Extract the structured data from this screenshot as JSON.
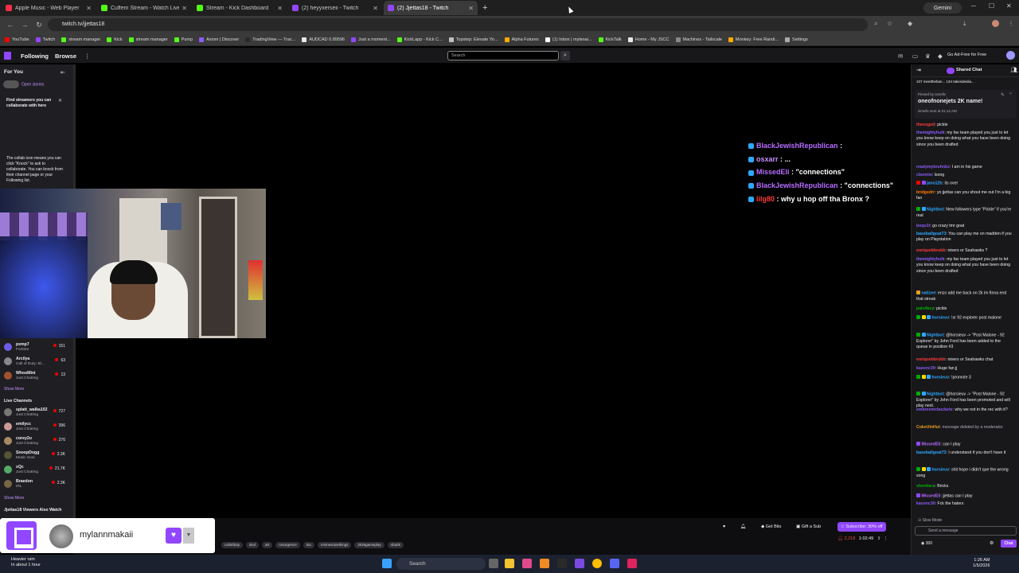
{
  "browser": {
    "tabs": [
      {
        "label": "Apple Music - Web Player",
        "color": "#fa2d48",
        "active": false
      },
      {
        "label": "Cuffem Stream - Watch Live on",
        "color": "#53fc18",
        "active": false
      },
      {
        "label": "Stream - Kick Dashboard",
        "color": "#53fc18",
        "active": false
      },
      {
        "label": "(2) heyyxerseii - Twitch",
        "color": "#9147ff",
        "active": false
      },
      {
        "label": "(2) Jjettas18 - Twitch",
        "color": "#9147ff",
        "active": true
      }
    ],
    "new_tab": "+",
    "gemini_label": "Gemini",
    "url": "twitch.tv/jjettas18",
    "bookmarks": [
      "YouTube",
      "Twitch",
      "stream manager",
      "Kick",
      "stream manager",
      "Pump",
      "Axiom | Discover",
      "TradingView — Trac...",
      "AUDCAD 0.89596",
      "Just a moment...",
      "KickLapp - Kick C...",
      "Topstep: Elevate Yo...",
      "Alpha Futures",
      "(1) Inbox | mylanai...",
      "KickTalk",
      "Home - My JSCC",
      "Machines - Tailscale",
      "Monkey: Free Randi...",
      "Settings"
    ]
  },
  "twitch_nav": {
    "following": "Following",
    "browse": "Browse",
    "search_placeholder": "Search",
    "ad_free": "Go Ad-Free for Free"
  },
  "sidebar": {
    "for_you": "For You",
    "open_stories": "Open stories",
    "find_streamers": "Find streamers you can collaborate with here",
    "collab_info": "The collab icon means you can click \"Knock\" to ask to collaborate. You can knock from their channel page or your Following list.",
    "followed": [
      {
        "name": "pxmp7",
        "game": "Fortnite",
        "viewers": "151"
      },
      {
        "name": "Arcilya",
        "game": "Call of Duty: Bl...",
        "viewers": "63"
      },
      {
        "name": "WhosMini",
        "game": "Just Chatting",
        "viewers": "13"
      }
    ],
    "show_more_1": "Show More",
    "live_channels_header": "Live Channels",
    "live_channels": [
      {
        "name": "splatt_walka102",
        "game": "Just Chatting",
        "viewers": "727"
      },
      {
        "name": "emilycc",
        "game": "Just Chatting",
        "viewers": "396"
      },
      {
        "name": "corey2u",
        "game": "Just Chatting",
        "viewers": "276"
      },
      {
        "name": "SnoopDogg",
        "game": "Music Soul",
        "viewers": "2.3K"
      },
      {
        "name": "xQc",
        "game": "Just Chatting",
        "viewers": "21.7K"
      },
      {
        "name": "Braedon",
        "game": "IRL",
        "viewers": "2.3K"
      }
    ],
    "show_more_2": "Show More",
    "viewers_also_watch": "Jjettas18 Viewers Also Watch"
  },
  "stream_overlay_chat": [
    {
      "user": "BlackJewishRepublican",
      "color": "#b56cff",
      "text": ":"
    },
    {
      "user": "osxarr",
      "color": "#c990ff",
      "text": ": ..."
    },
    {
      "user": "MissedEli",
      "color": "#b56cff",
      "text": ": \"connections\""
    },
    {
      "user": "BlackJewishRepublican",
      "color": "#b56cff",
      "text": ": \"connections\""
    },
    {
      "user": "lilg80",
      "color": "#ff3c3c",
      "text": ": why u hop off tha Bronx ?"
    }
  ],
  "stream_bar": {
    "get_bits": "Get Bits",
    "gift_sub": "Gift a Sub",
    "subscribe": "Subscribe: 30% off",
    "tags": [
      "callofduty",
      "skol",
      "art",
      "rosurgence",
      "tsu",
      "minnesotavikings",
      "2k26gameplay",
      "nba2k"
    ],
    "viewers": "2,218",
    "uptime": "1:02:49"
  },
  "popup": {
    "name": "mylannmakaii",
    "heart": "♥",
    "caret": "▼"
  },
  "chat": {
    "title": "Shared Chat",
    "shared_bar": "107 meettheban... 134 takesidedia...",
    "pinned_label": "Pinned by ismellv",
    "pinned_message": "oneofnonejets 2K name!",
    "pinned_sent": "ismellv sent at 01:12 AM",
    "messages": [
      {
        "user": "theoxgod",
        "color": "#ff3c3c",
        "text": ": pickle",
        "badges": []
      },
      {
        "user": "themightyhulk",
        "color": "#8a5cf6",
        "text": ": my fav team played you just to let you know keep on doing what you have been doing since you been drafted",
        "badges": []
      },
      {
        "user": "readymybruhnbz",
        "color": "#8a5cf6",
        "text": ": I am in his game",
        "badges": []
      },
      {
        "user": "cbonnie",
        "color": "#8a5cf6",
        "text": ": lsong",
        "badges": []
      },
      {
        "user": "jano12b",
        "color": "#2ea8ff",
        "text": ": its over",
        "badges": [
          "#eb0400",
          "#9147ff"
        ]
      },
      {
        "user": "bridgedrr",
        "color": "#ff7a00",
        "text": ": yo jjettas can you shout me out I'm a big fan",
        "badges": []
      },
      {
        "user": "Nightbot",
        "color": "#2ea8ff",
        "text": ": New followers type \"Pickle\" if you're real",
        "badges": [
          "#00ad03",
          "#2ea8ff"
        ]
      },
      {
        "user": "boqu1t",
        "color": "#8a5cf6",
        "text": ": go crazy tmr goat",
        "badges": []
      },
      {
        "user": "baseballgoat73",
        "color": "#2ea8ff",
        "text": ": You can play me on madden if you play on Playstation",
        "badges": []
      },
      {
        "user": "enriquebbrubb",
        "color": "#ff3c3c",
        "text": ": niners or Seahawks ?",
        "badges": []
      },
      {
        "user": "themightyhulk",
        "color": "#8a5cf6",
        "text": ": my fav team played you just to let you know keep on doing what you have been doing since you been drafted",
        "badges": []
      },
      {
        "user": "natizee",
        "color": "#2ea8ff",
        "text": ": enzo add me back on 2k im finna end that streak",
        "badges": [
          "#e6a020"
        ]
      },
      {
        "user": "pain4key",
        "color": "#00ad03",
        "text": ": pickle",
        "badges": []
      },
      {
        "user": "horsieuv",
        "color": "#2ea8ff",
        "text": ": !sr 92 explorer post malone",
        "badges": [
          "#00ad03",
          "#ffd700",
          "#2ea8ff"
        ]
      },
      {
        "user": "Nightbot",
        "color": "#2ea8ff",
        "text": ": @horsieuv -> \"Post Malone - 92 Explorer\" by John Ford has been added to the queue in position #3",
        "badges": [
          "#00ad03",
          "#2ea8ff"
        ]
      },
      {
        "user": "enriquebbrubb",
        "color": "#ff3c3c",
        "text": ": niners or Seahawks chat",
        "badges": []
      },
      {
        "user": "kasonc30",
        "color": "#8a5cf6",
        "text": ": Huge fan jj",
        "badges": []
      },
      {
        "user": "horsieuv",
        "color": "#2ea8ff",
        "text": ": !promote 3",
        "badges": [
          "#00ad03",
          "#ffd700",
          "#2ea8ff"
        ]
      },
      {
        "user": "Nightbot",
        "color": "#2ea8ff",
        "text": ": @horsieuv -> \"Post Malone - 92 Explorer\" by John Ford has been promoted and will play next.",
        "badges": [
          "#00ad03",
          "#2ea8ff"
        ]
      },
      {
        "user": "embreemcbuckets",
        "color": "#8a5cf6",
        "text": ": why we not in the rec with it?",
        "badges": []
      },
      {
        "user": "CokeUlnHut",
        "color": "#e6a020",
        "text": ": message deleted by a moderator.",
        "badges": [],
        "italic": true
      },
      {
        "user": "MissedEli",
        "color": "#b56cff",
        "text": ": can I play",
        "badges": [
          "#9147ff"
        ]
      },
      {
        "user": "baseballgoat73",
        "color": "#2ea8ff",
        "text": ": I understand if you don't have it",
        "badges": []
      },
      {
        "user": "horsieuv",
        "color": "#2ea8ff",
        "text": ": shit hope i didn't que the wrong song",
        "badges": [
          "#00ad03",
          "#ffd700",
          "#2ea8ff"
        ]
      },
      {
        "user": "shontiara",
        "color": "#00ad03",
        "text": ": Bricks",
        "badges": []
      },
      {
        "user": "MissedEli",
        "color": "#b56cff",
        "text": ": jjettas can I play",
        "badges": [
          "#9147ff"
        ]
      },
      {
        "user": "kasonc30",
        "color": "#8a5cf6",
        "text": ": Fck the haters",
        "badges": []
      }
    ],
    "slow_mode": "Slow Mode",
    "send_placeholder": "Send a message",
    "points": "300",
    "chat_button": "Chat"
  },
  "taskbar": {
    "weather_line1": "Heavier rain",
    "weather_line2": "In about 1 hour",
    "search_label": "Search",
    "time": "1:26 AM",
    "date": "1/5/2026"
  }
}
